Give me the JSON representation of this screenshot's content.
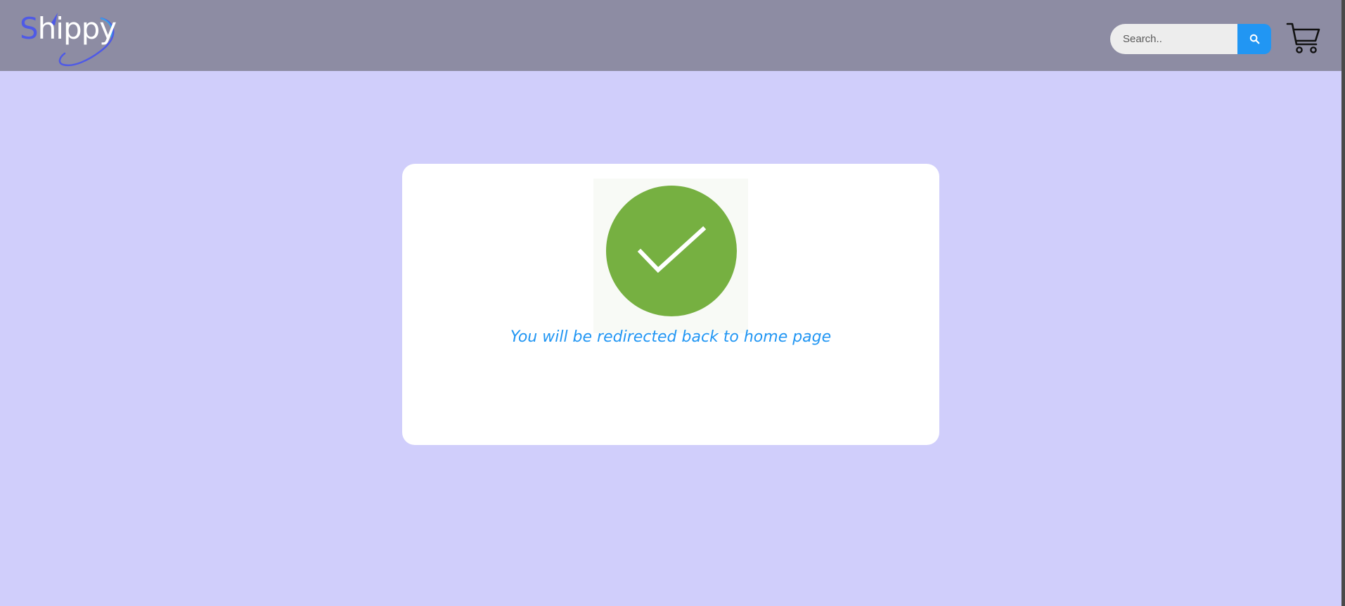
{
  "brand": {
    "name_first_letter": "S",
    "name_rest": "hippy",
    "accent_color": "#4f5ae6"
  },
  "header": {
    "background_color": "#8d8ca3",
    "search": {
      "placeholder": "Search..",
      "value": "",
      "button_icon": "search-icon",
      "button_color": "#2196f3"
    },
    "cart_icon": "shopping-cart-icon"
  },
  "page": {
    "background_color": "#d0cefb"
  },
  "confirmation": {
    "icon": "check-circle-icon",
    "icon_color": "#76b041",
    "message": "You will be redirected back to home page",
    "message_color": "#2196f3"
  }
}
